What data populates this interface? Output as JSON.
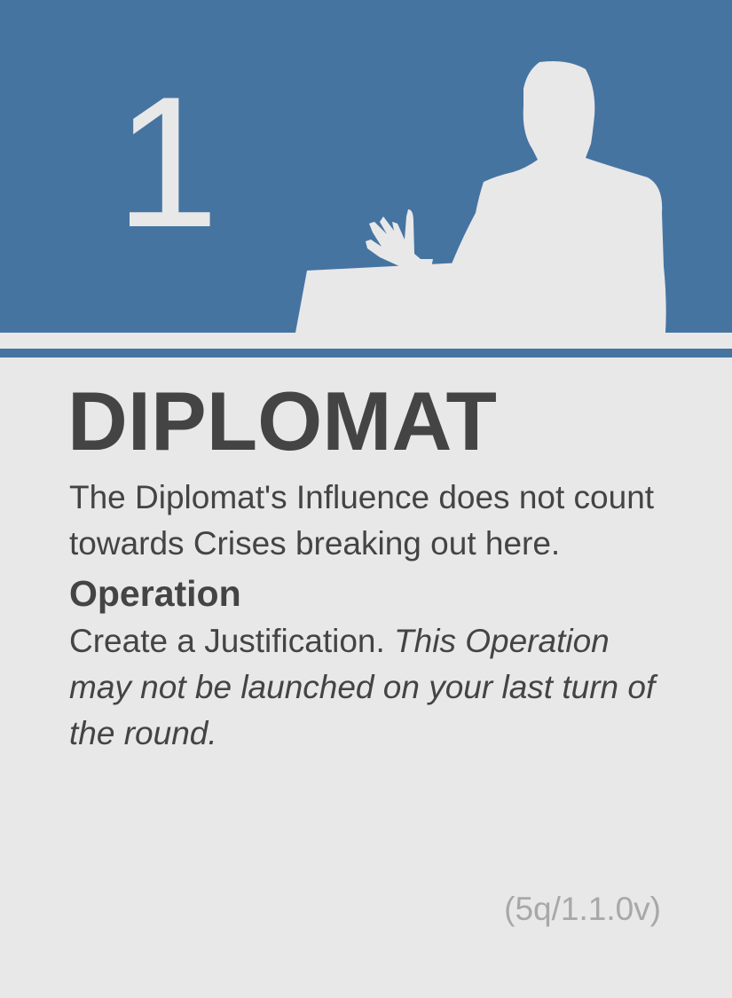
{
  "card": {
    "cost": "1",
    "title": "DIPLOMAT",
    "ability_text": "The Diplomat's Influence does not count towards Crises breaking out here.",
    "operation_heading": "Operation",
    "operation_text": "Create a Justification. ",
    "operation_note": "This Operation may not be launched on your last turn of the round.",
    "version": "(5q/1.1.0v)"
  },
  "colors": {
    "accent_blue": "#4674a1",
    "background": "#e8e8e9",
    "text": "#444444",
    "muted_text": "#a8a8a8"
  },
  "icons": {
    "illustration": "diplomat-silhouette-icon"
  }
}
